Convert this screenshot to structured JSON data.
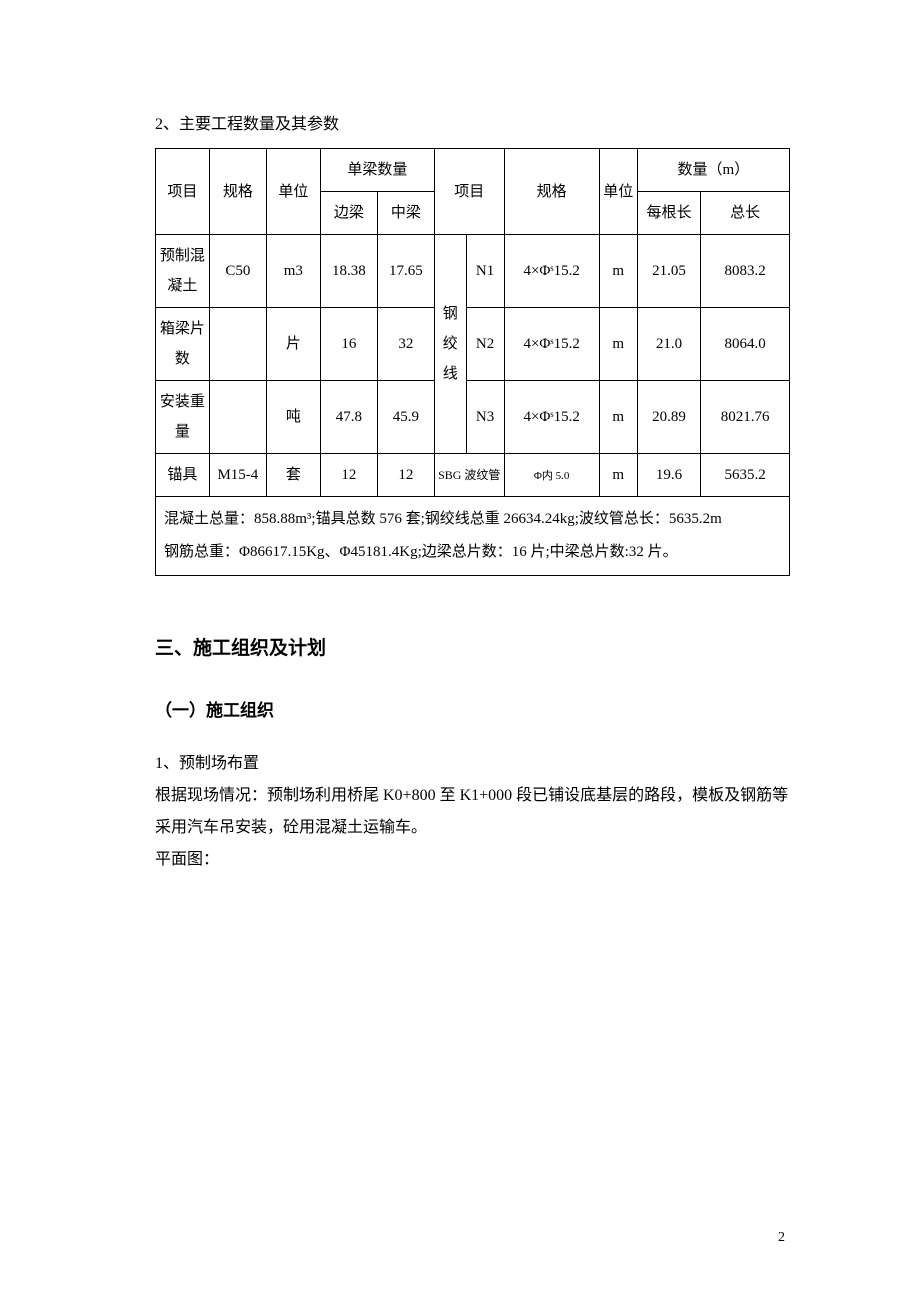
{
  "title_small": "2、主要工程数量及其参数",
  "table": {
    "headers": {
      "col_item": "项目",
      "col_spec": "规格",
      "col_unit": "单位",
      "col_single_qty": "单梁数量",
      "col_side": "边梁",
      "col_mid": "中梁",
      "col_item2": "项目",
      "col_spec2": "规格",
      "col_unit2": "单位",
      "col_qty_m": "数量（m）",
      "col_each_len": "每根长",
      "col_total_len": "总长"
    },
    "rows": [
      {
        "item": "预制混凝土",
        "spec": "C50",
        "unit": "m3",
        "side": "18.38",
        "mid": "17.65",
        "group2": "钢绞线",
        "item2": "N1",
        "spec2": "4×Φˢ15.2",
        "unit2": "m",
        "each": "21.05",
        "total": "8083.2"
      },
      {
        "item": "箱梁片数",
        "spec": "",
        "unit": "片",
        "side": "16",
        "mid": "32",
        "item2": "N2",
        "spec2": "4×Φˢ15.2",
        "unit2": "m",
        "each": "21.0",
        "total": "8064.0"
      },
      {
        "item": "安装重量",
        "spec": "",
        "unit": "吨",
        "side": "47.8",
        "mid": "45.9",
        "item2": "N3",
        "spec2": "4×Φˢ15.2",
        "unit2": "m",
        "each": "20.89",
        "total": "8021.76"
      },
      {
        "item": "锚具",
        "spec": "M15-4",
        "unit": "套",
        "side": "12",
        "mid": "12",
        "group2": "SBG 波纹管",
        "spec2": "Φ内 5.0",
        "unit2": "m",
        "each": "19.6",
        "total": "5635.2"
      }
    ],
    "summary_line1": "混凝土总量：858.88m³;锚具总数 576 套;钢绞线总重 26634.24kg;波纹管总长：5635.2m",
    "summary_line2": "钢筋总重：Φ86617.15Kg、Φ45181.4Kg;边梁总片数：16 片;中梁总片数:32 片。"
  },
  "heading3": "三、施工组织及计划",
  "heading4": "（一）施工组织",
  "body_num_title": "1、预制场布置",
  "body_p1": "根据现场情况：预制场利用桥尾 K0+800 至 K1+000 段已铺设底基层的路段，模板及钢筋等采用汽车吊安装，砼用混凝土运输车。",
  "body_p2": "平面图：",
  "page_number": "2",
  "chart_data": {
    "type": "table",
    "title": "主要工程数量及其参数",
    "left_section": {
      "columns": [
        "项目",
        "规格",
        "单位",
        "边梁",
        "中梁"
      ],
      "rows": [
        [
          "预制混凝土",
          "C50",
          "m3",
          18.38,
          17.65
        ],
        [
          "箱梁片数",
          "",
          "片",
          16,
          32
        ],
        [
          "安装重量",
          "",
          "吨",
          47.8,
          45.9
        ],
        [
          "锚具",
          "M15-4",
          "套",
          12,
          12
        ]
      ]
    },
    "right_section": {
      "columns": [
        "项目",
        "规格",
        "单位",
        "每根长(m)",
        "总长(m)"
      ],
      "rows": [
        [
          "钢绞线 N1",
          "4×Φs15.2",
          "m",
          21.05,
          8083.2
        ],
        [
          "钢绞线 N2",
          "4×Φs15.2",
          "m",
          21.0,
          8064.0
        ],
        [
          "钢绞线 N3",
          "4×Φs15.2",
          "m",
          20.89,
          8021.76
        ],
        [
          "SBG 波纹管",
          "Φ内5.0",
          "m",
          19.6,
          5635.2
        ]
      ]
    },
    "totals": {
      "混凝土总量_m3": 858.88,
      "锚具总数_套": 576,
      "钢绞线总重_kg": 26634.24,
      "波纹管总长_m": 5635.2,
      "钢筋总重_Φ1_kg": 86617.15,
      "钢筋总重_Φ2_kg": 45181.4,
      "边梁总片数": 16,
      "中梁总片数": 32
    }
  }
}
